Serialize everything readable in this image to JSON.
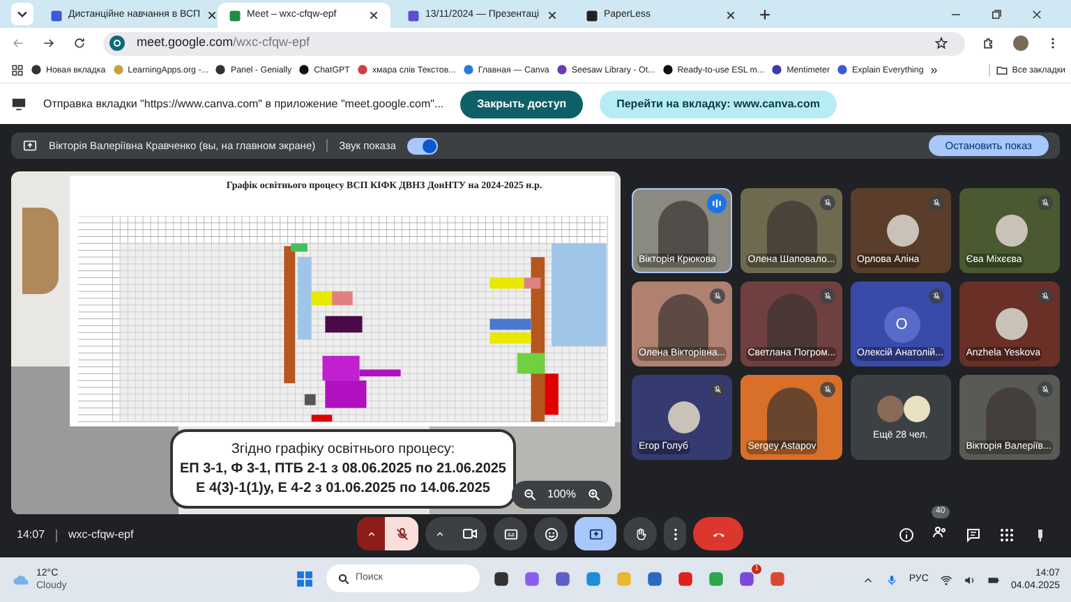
{
  "tabs": [
    {
      "title": "Дистанційне навчання в ВСП",
      "selected": false
    },
    {
      "title": "Meet – wxc-cfqw-epf",
      "selected": true
    },
    {
      "title": "13/11/2024 — Презентаці",
      "selected": false
    },
    {
      "title": "PaperLess",
      "selected": false
    }
  ],
  "address": {
    "host": "meet.google.com",
    "path": "/wxc-cfqw-epf"
  },
  "bookmarks": [
    "Новая вкладка",
    "LearningApps.org -...",
    "Panel - Genially",
    "ChatGPT",
    "хмара слів Текстов...",
    "Главная — Canva",
    "Seesaw Library - Ot...",
    "Ready-to-use ESL m...",
    "Mentimeter",
    "Explain Everything"
  ],
  "bookmarks_more": "»",
  "all_bookmarks": "Все закладки",
  "share_bar": {
    "message": "Отправка вкладки \"https://www.canva.com\" в приложение \"meet.google.com\"...",
    "stop_button": "Закрыть доступ",
    "go_button": "Перейти на вкладку: www.canva.com"
  },
  "presenting_bar": {
    "presenter": "Вікторія Валеріївна Кравченко (вы, на главном экране)",
    "audio_label": "Звук показа",
    "audio_on": true,
    "stop_button": "Остановить показ"
  },
  "slide": {
    "title": "Графік освітнього процесу ВСП КІФК ДВНЗ ДонНТУ на 2024-2025 н.р.",
    "notice": [
      "Згідно графіку освітнього процесу:",
      "ЕП 3-1, Ф 3-1, ПТБ 2-1 з 08.06.2025 по 21.06.2025",
      "Е 4(3)-1(1)у, Е 4-2 з 01.06.2025 по 14.06.2025"
    ],
    "zoom": "100%"
  },
  "participants": [
    {
      "name": "Вікторія Крюкова",
      "kind": "video",
      "speaking": true,
      "selected": true,
      "color": "#8a8a80"
    },
    {
      "name": "Олена Шаповало...",
      "kind": "video",
      "speaking": false,
      "selected": false,
      "color": "#6e6a50"
    },
    {
      "name": "Орлова Аліна",
      "kind": "avatar",
      "speaking": false,
      "selected": false,
      "color": "#5a3d2a"
    },
    {
      "name": "Єва Міхєєва",
      "kind": "avatar",
      "speaking": false,
      "selected": false,
      "color": "#4a5a30"
    },
    {
      "name": "Олена Вікторівна...",
      "kind": "video",
      "speaking": false,
      "selected": false,
      "color": "#b08070"
    },
    {
      "name": "Светлана Погром...",
      "kind": "video",
      "speaking": false,
      "selected": false,
      "color": "#704040"
    },
    {
      "name": "Олексій Анатолій...",
      "kind": "letter",
      "letter": "О",
      "speaking": false,
      "selected": false,
      "color": "#3a4aa8"
    },
    {
      "name": "Anzhela Yeskova",
      "kind": "avatar",
      "speaking": false,
      "selected": false,
      "color": "#6a3028"
    },
    {
      "name": "Егор Голуб",
      "kind": "avatar",
      "speaking": false,
      "selected": false,
      "color": "#353a70"
    },
    {
      "name": "Sergey Astapov",
      "kind": "video",
      "speaking": false,
      "selected": false,
      "color": "#d8702a"
    },
    {
      "name": "Ещё 28 чел.",
      "kind": "more",
      "color": "#3c4043"
    },
    {
      "name": "Вікторія Валеріїв...",
      "kind": "video",
      "speaking": false,
      "selected": false,
      "color": "#5a5a55"
    }
  ],
  "call_bar": {
    "time": "14:07",
    "code": "wxc-cfqw-epf",
    "participant_count": "40",
    "controls": [
      {
        "kind": "mic",
        "muted": true
      },
      {
        "kind": "camera",
        "muted": false
      },
      {
        "kind": "captions"
      },
      {
        "kind": "emoji"
      },
      {
        "kind": "present",
        "active": true
      },
      {
        "kind": "hand"
      },
      {
        "kind": "more"
      },
      {
        "kind": "leave"
      }
    ]
  },
  "taskbar": {
    "temperature": "12°C",
    "weather": "Cloudy",
    "search_placeholder": "Поиск",
    "language": "РУС",
    "time": "14:07",
    "date": "04.04.2025",
    "notification_count": "1"
  }
}
